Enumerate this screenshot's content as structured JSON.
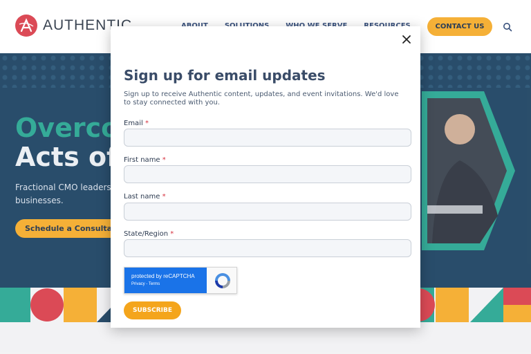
{
  "header": {
    "logo_text": "AUTHENTIC",
    "nav": [
      "ABOUT",
      "SOLUTIONS",
      "WHO WE SERVE",
      "RESOURCES"
    ],
    "contact_label": "CONTACT US"
  },
  "hero": {
    "title_line1": "Overco",
    "title_line2": "Acts of",
    "text": "Fractional CMO leadersh businesses.",
    "cta_label": "Schedule a Consultatio"
  },
  "modal": {
    "title": "Sign up for email updates",
    "description": "Sign up to receive Authentic content, updates, and event invitations. We'd love to stay connected with you.",
    "fields": [
      {
        "label": "Email",
        "required_mark": "*",
        "value": ""
      },
      {
        "label": "First name",
        "required_mark": "*",
        "value": ""
      },
      {
        "label": "Last name",
        "required_mark": "*",
        "value": ""
      },
      {
        "label": "State/Region",
        "required_mark": "*",
        "value": ""
      }
    ],
    "recaptcha": {
      "protected_text": "protected by reCAPTCHA",
      "links_text": "Privacy - Terms"
    },
    "submit_label": "SUBSCRIBE"
  },
  "colors": {
    "accent": "#f4a51c",
    "brand_red": "#d6313f",
    "hero_bg": "#0c3557",
    "teal": "#1aa08a",
    "title": "#3a4c68"
  }
}
